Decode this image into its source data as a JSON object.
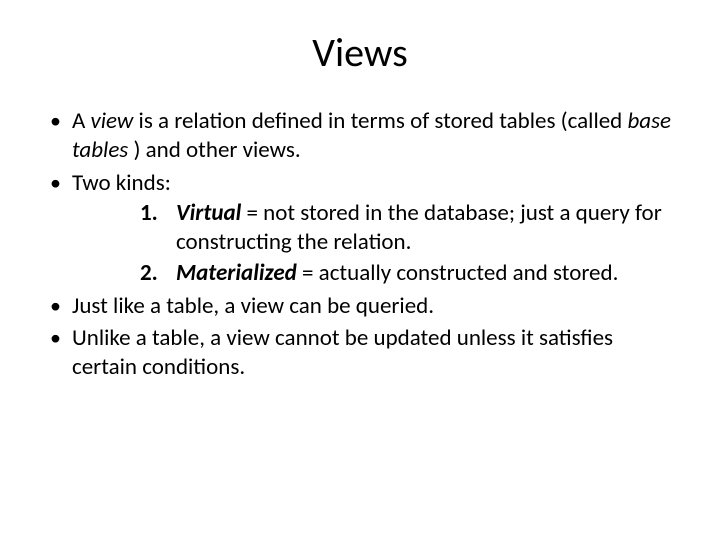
{
  "title": "Views",
  "bullets": {
    "b1": {
      "pre": "A ",
      "term": "view",
      "mid": "  is a relation defined in terms of stored tables (called ",
      "term2": "base tables",
      "post": " ) and other views."
    },
    "b2": {
      "text": "Two kinds:"
    },
    "kinds": {
      "k1": {
        "num": "1.",
        "term": "Virtual",
        "rest": "  = not stored in the database; just a query for constructing the relation."
      },
      "k2": {
        "num": "2.",
        "term": "Materialized",
        "rest": "  = actually constructed and stored."
      }
    },
    "b3": {
      "text": "Just like a table, a view can be queried."
    },
    "b4": {
      "text": "Unlike a table, a view cannot be updated unless it satisfies certain conditions."
    }
  }
}
